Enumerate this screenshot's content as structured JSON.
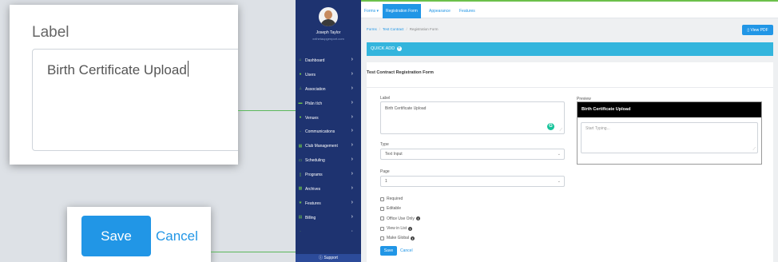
{
  "callouts": {
    "label_title": "Label",
    "label_value": "Birth Certificate Upload",
    "save_label": "Save",
    "cancel_label": "Cancel"
  },
  "user": {
    "name": "Joseph Taylor",
    "email": "xxthetaupgenport.com"
  },
  "sidebar": {
    "items": [
      {
        "label": "Dashboard",
        "icon": "home-icon"
      },
      {
        "label": "Users",
        "icon": "users-icon"
      },
      {
        "label": "Association",
        "icon": "sitemap-icon"
      },
      {
        "label": "Phân tích",
        "icon": "chart-icon"
      },
      {
        "label": "Venues",
        "icon": "map-pin-icon"
      },
      {
        "label": "Communications",
        "icon": "chat-icon"
      },
      {
        "label": "Club Management",
        "icon": "grid-icon"
      },
      {
        "label": "Scheduling",
        "icon": "calendar-icon"
      },
      {
        "label": "Programs",
        "icon": "document-icon"
      },
      {
        "label": "Archives",
        "icon": "archive-icon"
      },
      {
        "label": "Features",
        "icon": "star-icon"
      },
      {
        "label": "Billing",
        "icon": "billing-icon"
      },
      {
        "label": "",
        "icon": "more-icon"
      }
    ],
    "support": "Support"
  },
  "topbar": {
    "tabs": [
      {
        "label": "Forms ▾",
        "active": false
      },
      {
        "label": "Registration Form",
        "active": true
      },
      {
        "label": "Appearance",
        "active": false
      },
      {
        "label": "Features",
        "active": false
      }
    ]
  },
  "breadcrumb": {
    "items": [
      "Forms",
      "Test Contract",
      "Registration Form"
    ]
  },
  "view_pdf": "View PDF",
  "quick_add": "QUICK ADD",
  "form": {
    "title": "Test Contract Registration Form",
    "label_caption": "Label",
    "label_value": "Birth Certificate Upload",
    "type_caption": "Type",
    "type_value": "Text Input",
    "page_caption": "Page",
    "page_value": "1",
    "checkboxes": [
      {
        "label": "Required",
        "info": false,
        "checked": false
      },
      {
        "label": "Editable",
        "info": false,
        "checked": false
      },
      {
        "label": "Office Use Only",
        "info": true,
        "checked": false
      },
      {
        "label": "View in List",
        "info": true,
        "checked": false
      },
      {
        "label": "Make Global",
        "info": true,
        "checked": false
      }
    ],
    "save_label": "Save",
    "cancel_label": "Cancel"
  },
  "preview": {
    "caption": "Preview",
    "heading": "Birth Certificate Upload",
    "placeholder": "Start Typing..."
  },
  "colors": {
    "primary": "#2196e6",
    "sidebar": "#1e3370",
    "accent_green": "#6cc04a",
    "quick_add_bar": "#33b5dd"
  }
}
